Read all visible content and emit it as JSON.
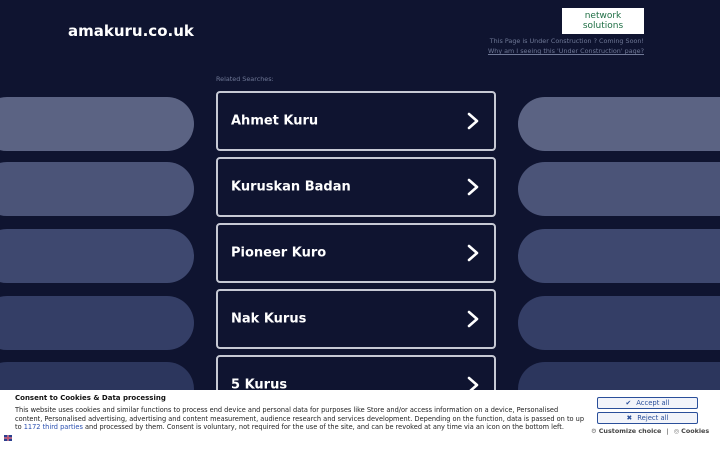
{
  "header": {
    "domain": "amakuru.co.uk",
    "logo_line1": "network",
    "logo_line2": "solutions",
    "construction_text": "This Page is Under Construction ? Coming Soon!",
    "construction_link": "Why am I seeing this 'Under Construction' page?"
  },
  "related": {
    "label": "Related Searches:",
    "items": [
      {
        "label": "Ahmet Kuru"
      },
      {
        "label": "Kuruskan Badan"
      },
      {
        "label": "Pioneer Kuro"
      },
      {
        "label": "Nak Kurus"
      },
      {
        "label": "5 Kurus"
      }
    ]
  },
  "colors": {
    "background": "#0f1430",
    "pill_shades": [
      "#5b6383",
      "#4b5478",
      "#3e486f",
      "#343e66",
      "#2c365d",
      "#252f56"
    ]
  },
  "consent": {
    "title": "Consent to Cookies & Data processing",
    "text_before_link": "This website uses cookies and similar functions to process end device and personal data for purposes like Store and/or access information on a device, Personalised content, Personalised advertising, advertising and content measurement, audience research and services development. Depending on the function, data is passed on to up to ",
    "link_text": "1172 third parties",
    "text_after_link": " and processed by them. Consent is voluntary, not required for the use of the site, and can be revoked at any time via an icon on the bottom left.",
    "accept_label": "Accept all",
    "reject_label": "Reject all",
    "customize_label": "Customize choice",
    "cookies_label": "Cookies",
    "separator": "|"
  }
}
